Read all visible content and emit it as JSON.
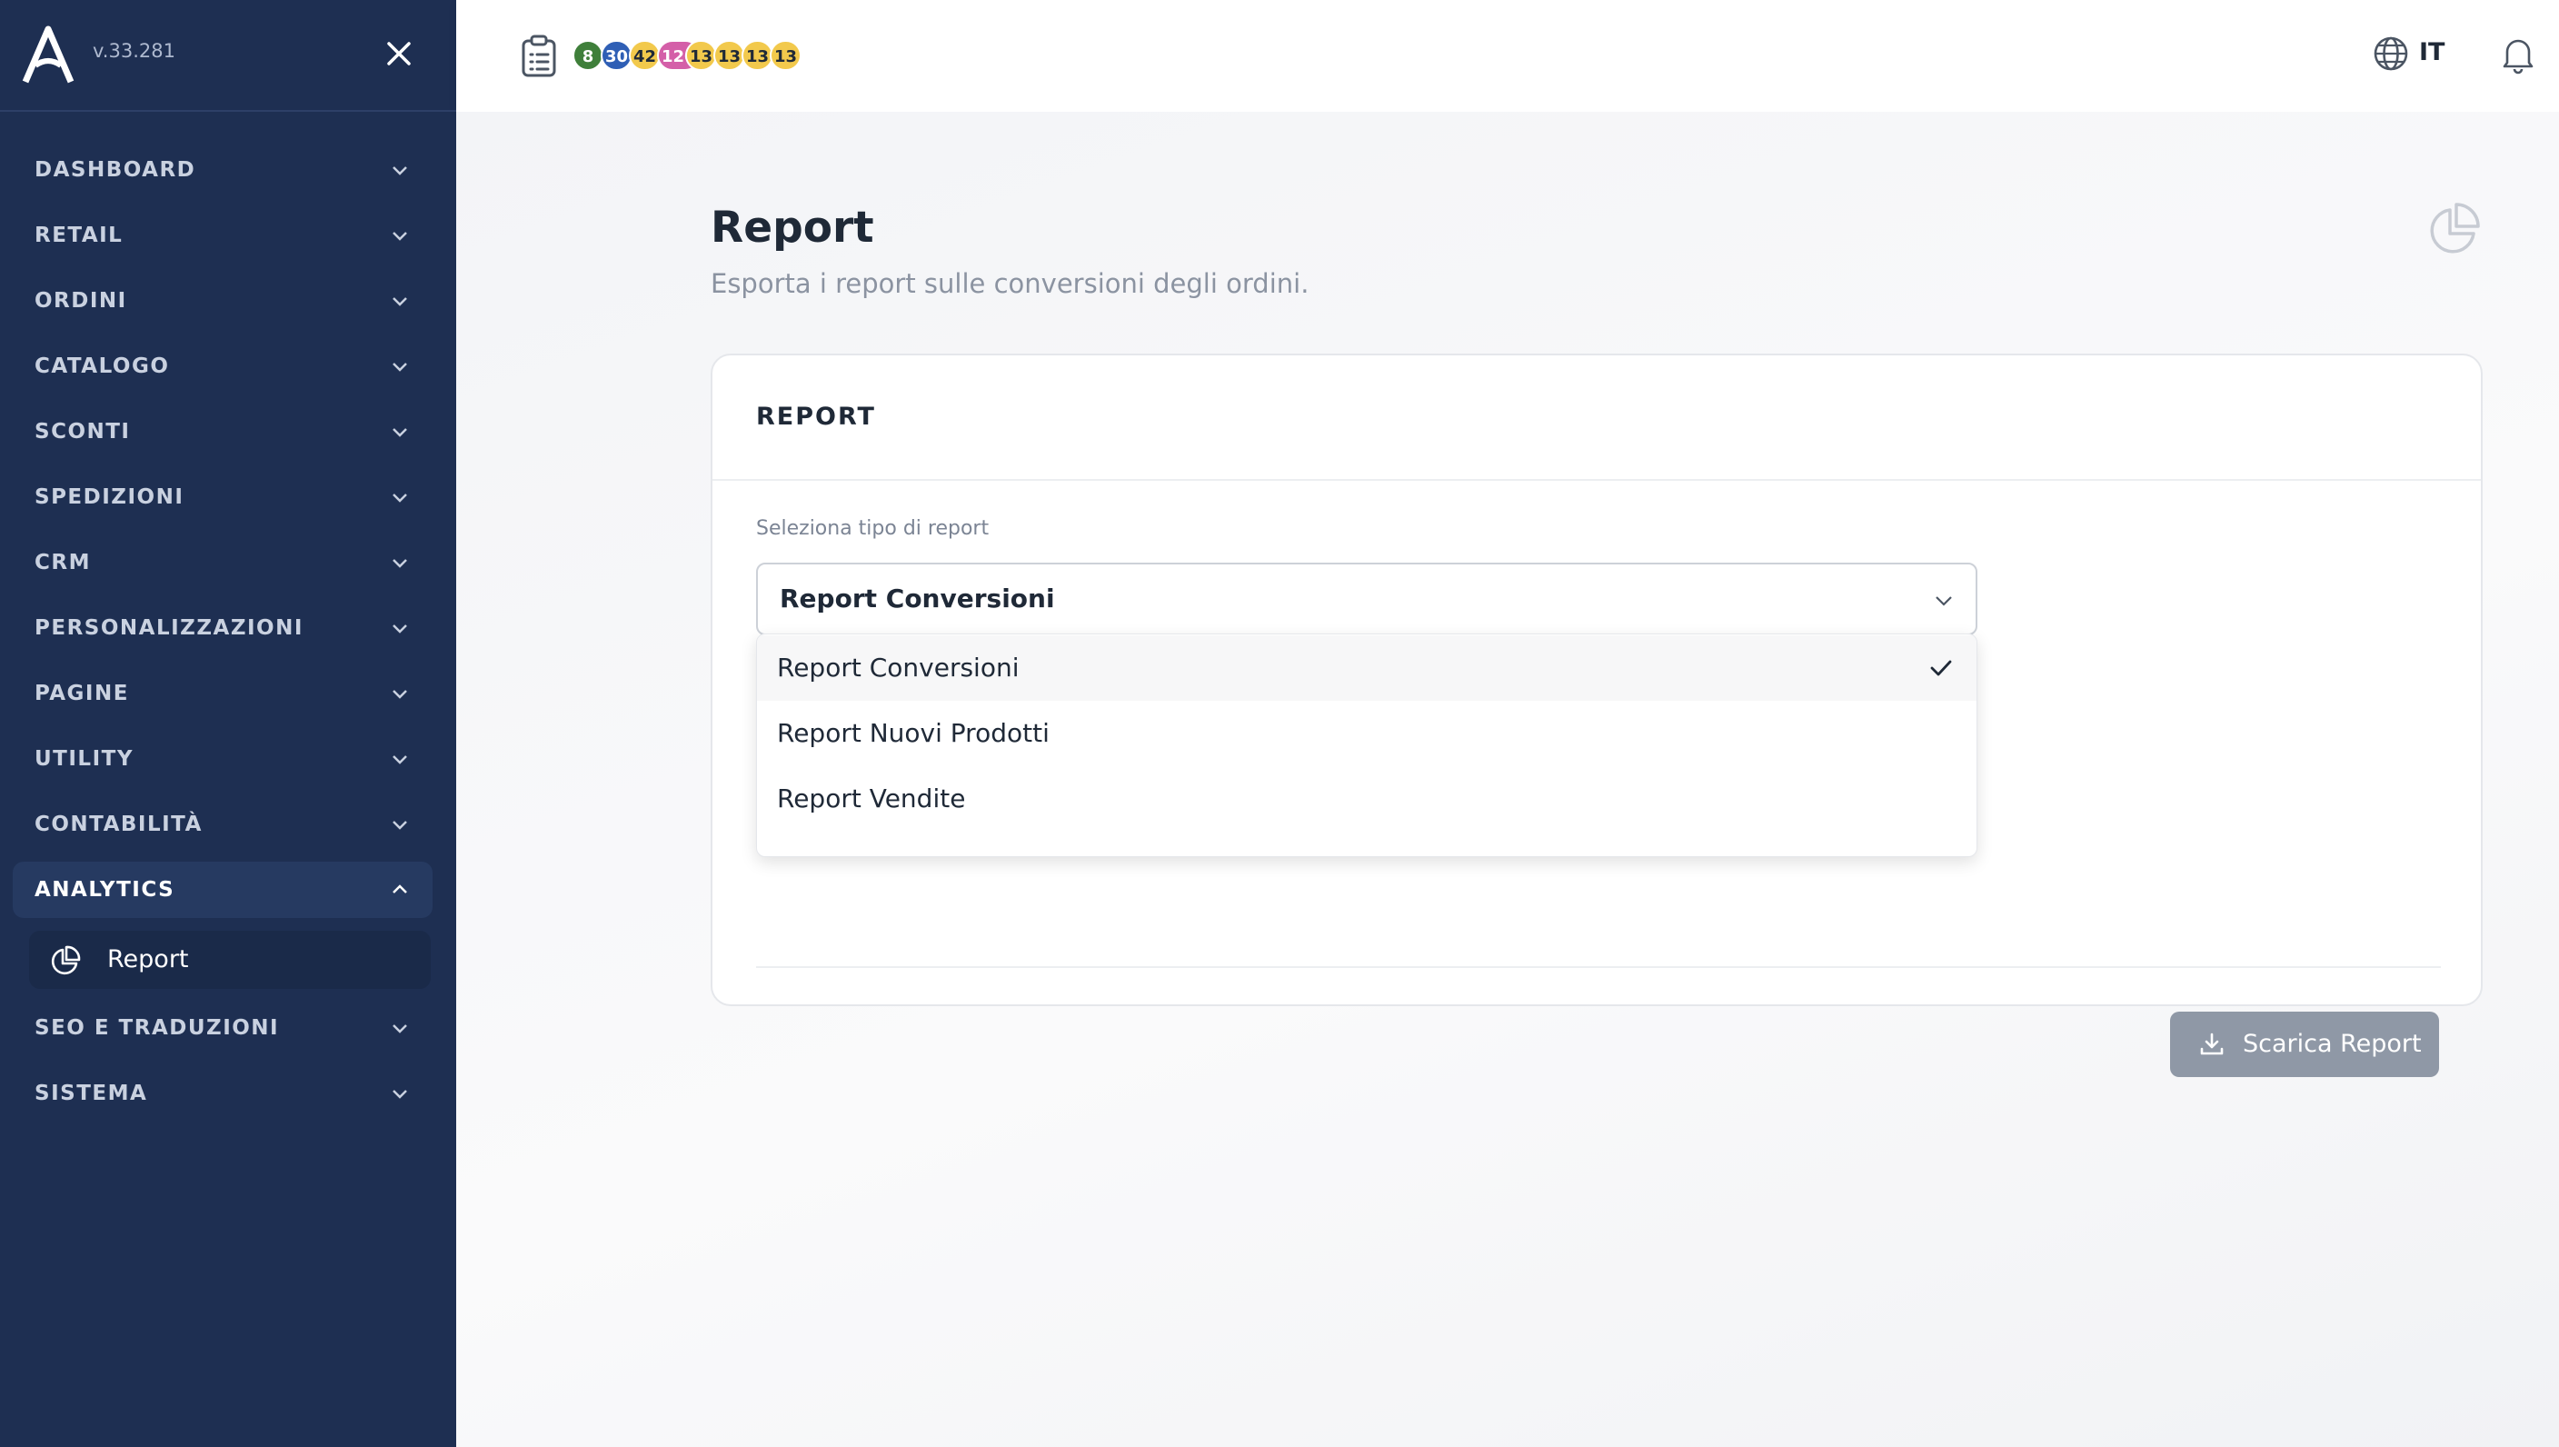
{
  "app": {
    "version": "v.33.281"
  },
  "sidebar": {
    "items": [
      {
        "label": "DASHBOARD"
      },
      {
        "label": "RETAIL"
      },
      {
        "label": "ORDINI"
      },
      {
        "label": "CATALOGO"
      },
      {
        "label": "SCONTI"
      },
      {
        "label": "SPEDIZIONI"
      },
      {
        "label": "CRM"
      },
      {
        "label": "PERSONALIZZAZIONI"
      },
      {
        "label": "PAGINE"
      },
      {
        "label": "UTILITY"
      },
      {
        "label": "CONTABILITÀ"
      },
      {
        "label": "ANALYTICS",
        "expanded": true
      },
      {
        "label": "SEO E TRADUZIONI"
      },
      {
        "label": "SISTEMA"
      }
    ],
    "analytics_sub": {
      "label": "Report",
      "icon": "pie-chart-icon"
    }
  },
  "topbar": {
    "badges": [
      {
        "value": "8",
        "color": "#3f7f3a",
        "text_color": "#ffffff"
      },
      {
        "value": "30",
        "color": "#2f5fb5",
        "text_color": "#ffffff"
      },
      {
        "value": "42",
        "color": "#f2c94c",
        "text_color": "#1f2937"
      },
      {
        "value": "120",
        "color": "#d45fa8",
        "text_color": "#ffffff"
      },
      {
        "value": "13",
        "color": "#f2c94c",
        "text_color": "#1f2937"
      },
      {
        "value": "13",
        "color": "#f2c94c",
        "text_color": "#1f2937"
      },
      {
        "value": "13",
        "color": "#f2c94c",
        "text_color": "#1f2937"
      },
      {
        "value": "13",
        "color": "#f2c94c",
        "text_color": "#1f2937"
      }
    ],
    "language": "IT"
  },
  "page": {
    "title": "Report",
    "subtitle": "Esporta i report sulle conversioni degli ordini."
  },
  "card": {
    "title": "REPORT",
    "select_label": "Seleziona tipo di report",
    "select_value": "Report Conversioni",
    "options": [
      {
        "label": "Report Conversioni",
        "selected": true
      },
      {
        "label": "Report Nuovi Prodotti",
        "selected": false
      },
      {
        "label": "Report Vendite",
        "selected": false
      }
    ],
    "download_label": "Scarica Report"
  },
  "colors": {
    "sidebar_bg": "#1e2f52",
    "button_disabled": "#8f98a6"
  }
}
